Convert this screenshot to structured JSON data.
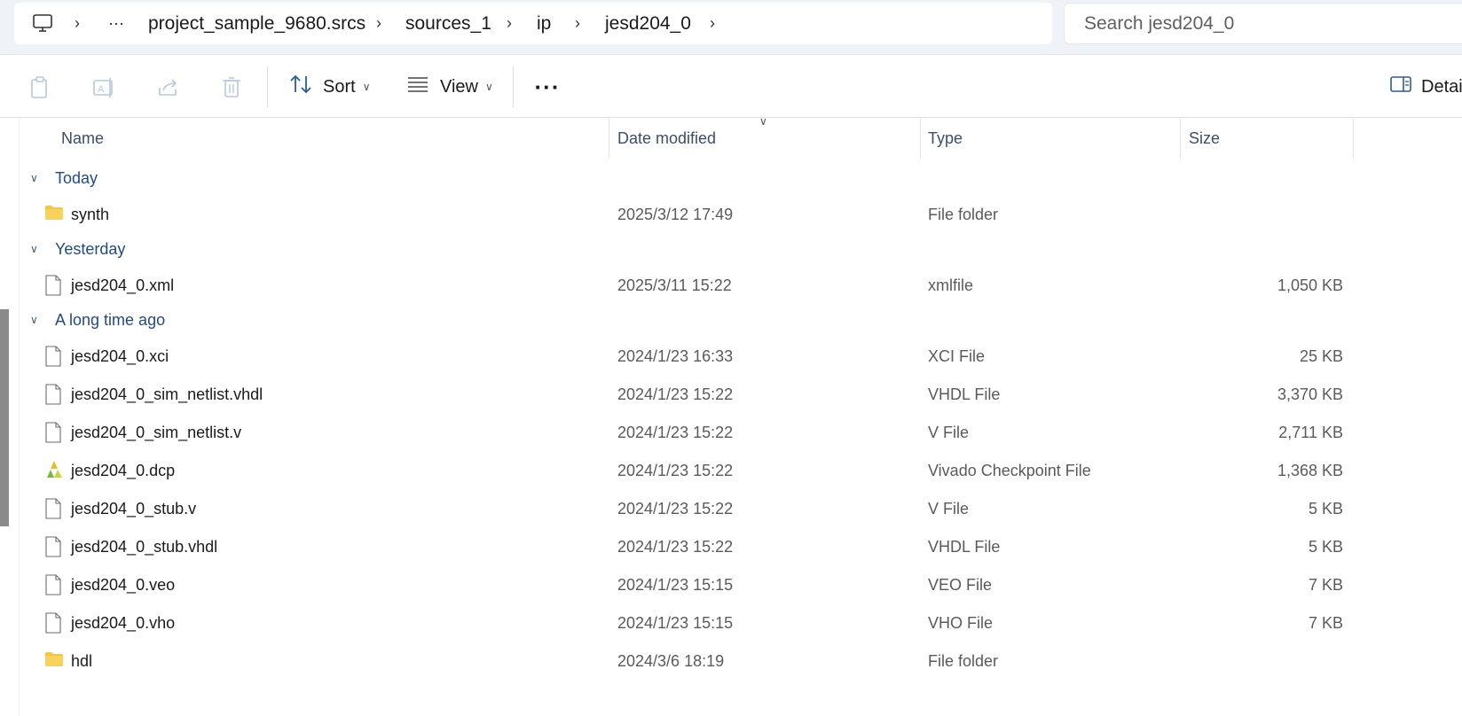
{
  "address_bar": {
    "breadcrumbs": [
      "project_sample_9680.srcs",
      "sources_1",
      "ip",
      "jesd204_0"
    ],
    "overflow": "···"
  },
  "search": {
    "placeholder": "Search jesd204_0"
  },
  "command_bar": {
    "sort_label": "Sort",
    "view_label": "View",
    "more_label": "···",
    "details_label": "Details"
  },
  "columns": {
    "name": "Name",
    "date": "Date modified",
    "type": "Type",
    "size": "Size"
  },
  "groups": [
    {
      "label": "Today",
      "items": [
        {
          "name": "synth",
          "date": "2025/3/12 17:49",
          "type": "File folder",
          "size": "",
          "icon": "folder-icon"
        }
      ]
    },
    {
      "label": "Yesterday",
      "items": [
        {
          "name": "jesd204_0.xml",
          "date": "2025/3/11 15:22",
          "type": "xmlfile",
          "size": "1,050 KB",
          "icon": "file-icon"
        }
      ]
    },
    {
      "label": "A long time ago",
      "items": [
        {
          "name": "jesd204_0.xci",
          "date": "2024/1/23 16:33",
          "type": "XCI File",
          "size": "25 KB",
          "icon": "file-icon"
        },
        {
          "name": "jesd204_0_sim_netlist.vhdl",
          "date": "2024/1/23 15:22",
          "type": "VHDL File",
          "size": "3,370 KB",
          "icon": "file-icon"
        },
        {
          "name": "jesd204_0_sim_netlist.v",
          "date": "2024/1/23 15:22",
          "type": "V File",
          "size": "2,711 KB",
          "icon": "file-icon"
        },
        {
          "name": "jesd204_0.dcp",
          "date": "2024/1/23 15:22",
          "type": "Vivado Checkpoint File",
          "size": "1,368 KB",
          "icon": "vivado-icon"
        },
        {
          "name": "jesd204_0_stub.v",
          "date": "2024/1/23 15:22",
          "type": "V File",
          "size": "5 KB",
          "icon": "file-icon"
        },
        {
          "name": "jesd204_0_stub.vhdl",
          "date": "2024/1/23 15:22",
          "type": "VHDL File",
          "size": "5 KB",
          "icon": "file-icon"
        },
        {
          "name": "jesd204_0.veo",
          "date": "2024/1/23 15:15",
          "type": "VEO File",
          "size": "7 KB",
          "icon": "file-icon"
        },
        {
          "name": "jesd204_0.vho",
          "date": "2024/1/23 15:15",
          "type": "VHO File",
          "size": "7 KB",
          "icon": "file-icon"
        },
        {
          "name": "hdl",
          "date": "2024/3/6 18:19",
          "type": "File folder",
          "size": "",
          "icon": "folder-icon"
        }
      ]
    }
  ],
  "colors": {
    "group_text": "#1f4a8a",
    "folder": "#f4c542",
    "vivado_yellow": "#e6c02a",
    "vivado_green": "#7cb342"
  }
}
